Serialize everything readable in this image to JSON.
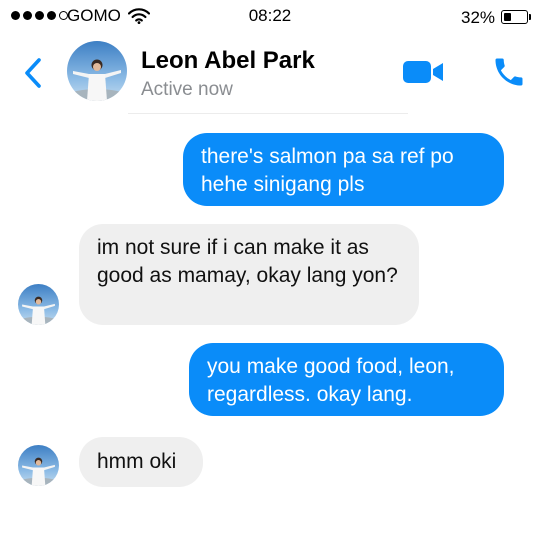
{
  "status_bar": {
    "carrier": "GOMO",
    "time": "08:22",
    "battery_percent": "32%",
    "battery_level": 0.32,
    "signal_bars_filled": 4,
    "signal_bars_total": 5
  },
  "header": {
    "contact_name": "Leon Abel Park",
    "contact_status": "Active now",
    "back_icon": "chevron-left-icon",
    "video_icon": "video-camera-icon",
    "call_icon": "phone-icon",
    "accent_color": "#0a8cf9"
  },
  "messages": [
    {
      "direction": "outgoing",
      "text": "there's salmon pa sa ref po hehe sinigang pls"
    },
    {
      "direction": "incoming",
      "text": "im not sure if i can make it as good as mamay, okay lang yon?"
    },
    {
      "direction": "outgoing",
      "text": "you make good food, leon, regardless. okay lang."
    },
    {
      "direction": "incoming",
      "text": "hmm oki"
    }
  ],
  "colors": {
    "outgoing_bubble": "#0a8cf9",
    "incoming_bubble": "#efefef",
    "status_text": "#8a8d91"
  }
}
